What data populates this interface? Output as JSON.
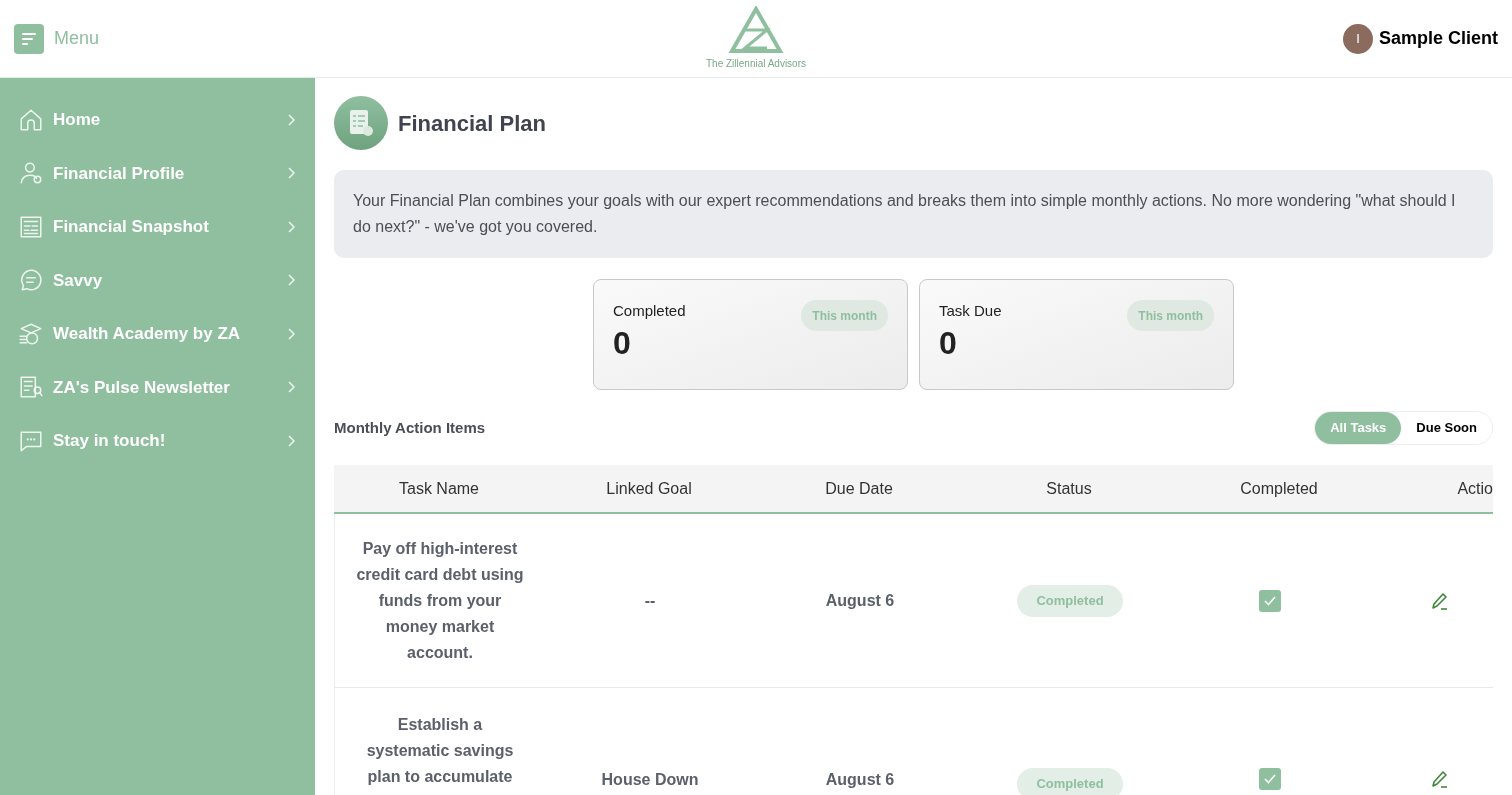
{
  "header": {
    "menu_label": "Menu",
    "brand": "The Zillennial Advisors",
    "user": {
      "initial": "I",
      "name": "Sample Client"
    }
  },
  "sidebar": {
    "items": [
      {
        "label": "Home"
      },
      {
        "label": "Financial Profile"
      },
      {
        "label": "Financial Snapshot"
      },
      {
        "label": "Savvy"
      },
      {
        "label": "Wealth Academy by ZA"
      },
      {
        "label": "ZA's Pulse Newsletter"
      },
      {
        "label": "Stay in touch!"
      }
    ]
  },
  "page": {
    "title": "Financial Plan",
    "intro": "Your Financial Plan combines your goals with our expert recommendations and breaks them into simple monthly actions. No more wondering \"what should I do next?\" - we've got you covered."
  },
  "stats": [
    {
      "label": "Completed",
      "badge": "This month",
      "value": "0"
    },
    {
      "label": "Task Due",
      "badge": "This month",
      "value": "0"
    }
  ],
  "actions": {
    "title": "Monthly Action Items",
    "filters": [
      {
        "label": "All Tasks",
        "selected": true
      },
      {
        "label": "Due Soon",
        "selected": false
      }
    ]
  },
  "table": {
    "columns": [
      "Task Name",
      "Linked Goal",
      "Due Date",
      "Status",
      "Completed",
      "Actio"
    ],
    "rows": [
      {
        "task": "Pay off high-interest credit card debt using funds from your money market account.",
        "goal": "--",
        "due": "August 6",
        "status": "Completed",
        "completed": true
      },
      {
        "task": "Establish a systematic savings plan to accumulate",
        "goal": "House Down",
        "due": "August 6",
        "status": "Completed",
        "completed": true
      }
    ]
  }
}
